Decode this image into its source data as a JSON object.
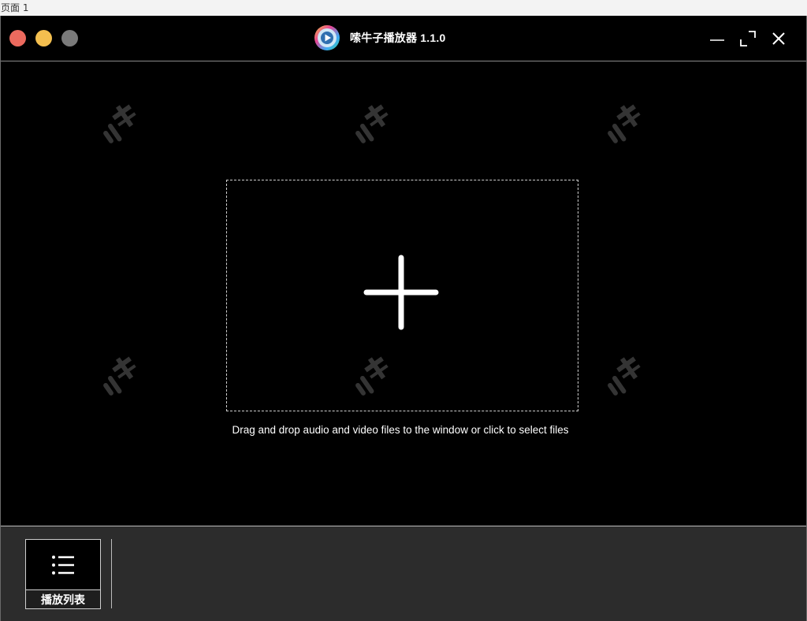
{
  "page_tab": {
    "label": "页面 1"
  },
  "titlebar": {
    "app_name": "嗦牛子播放器 1.1.0",
    "logo_icon": "play-disc-icon",
    "traffic_colors": {
      "close": "#ec6a5e",
      "minimize": "#f4bf4f",
      "zoom": "#7a7a7a"
    },
    "window_controls": [
      "minimize-icon",
      "maximize-icon",
      "close-icon"
    ]
  },
  "main": {
    "drop_icon": "plus-icon",
    "drop_hint": "Drag and drop audio and video files to the window or click to select files"
  },
  "bottom_bar": {
    "playlist_icon": "list-icon",
    "playlist_label": "播放列表"
  }
}
